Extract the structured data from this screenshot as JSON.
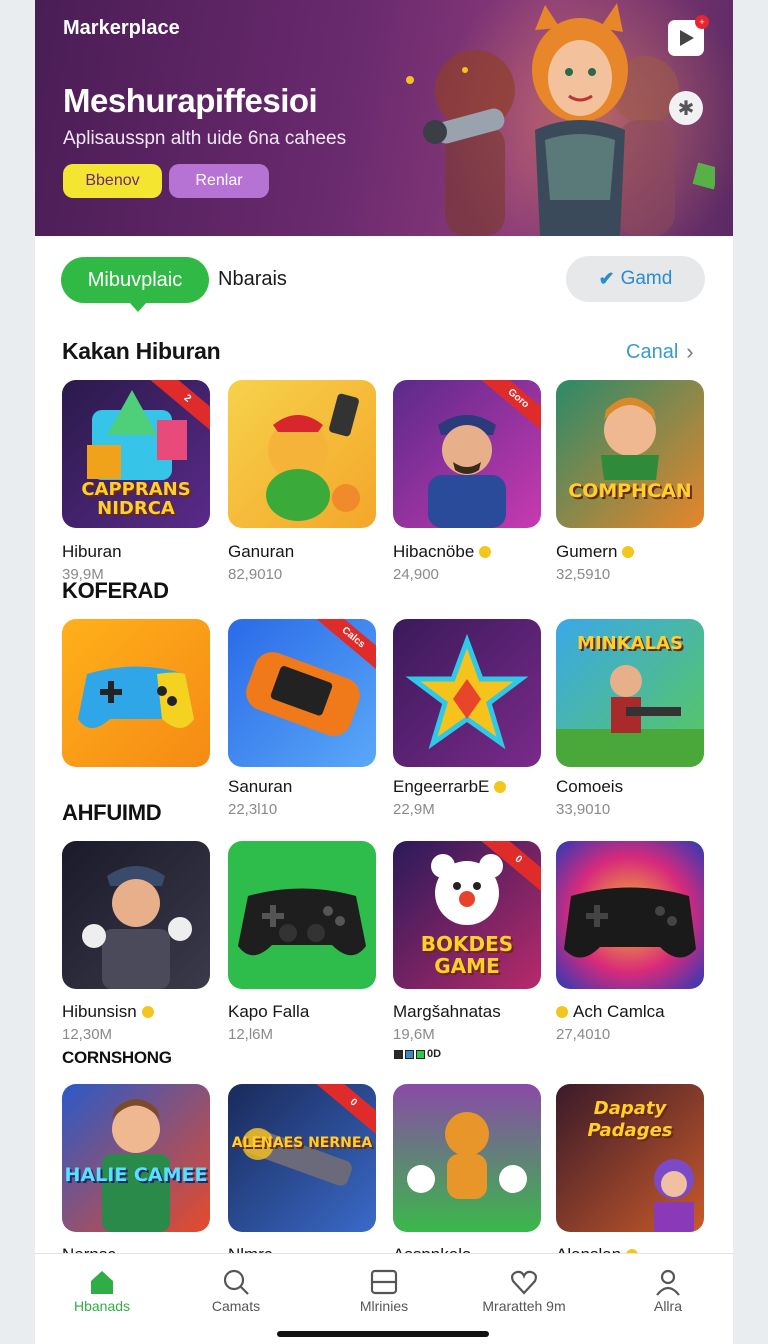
{
  "hero": {
    "market_label": "Markerplace",
    "title": "Meshurapiffesioi",
    "subtitle": "Aplisausspn alth uide 6na cahees",
    "button_primary": "Bbenov",
    "button_secondary": "Renlar"
  },
  "tabs": {
    "active": "Mibuvplaic",
    "other": "Nbarais",
    "game_button": "Gamd"
  },
  "section": {
    "title": "Kakan Hiburan",
    "see_all": "Canal"
  },
  "row_labels": [
    "KOFERAD",
    "AHFUIMD",
    "CORNSHONG"
  ],
  "rows": [
    [
      {
        "name": "Hiburan",
        "count": "39,9M",
        "coin": false,
        "tile_text": "CAPPRANS NIDRCA",
        "ribbon": "2"
      },
      {
        "name": "Ganuran",
        "count": "82,9010",
        "coin": false,
        "tile_text": "",
        "ribbon": ""
      },
      {
        "name": "Hibacnöbe",
        "count": "24,900",
        "coin": true,
        "tile_text": "",
        "ribbon": "Goro"
      },
      {
        "name": "Gumern",
        "count": "32,5910",
        "coin": true,
        "tile_text": "COMPHCAN",
        "ribbon": ""
      }
    ],
    [
      {
        "name": "",
        "count": "",
        "coin": false,
        "tile_text": "",
        "ribbon": ""
      },
      {
        "name": "Sanuran",
        "count": "22,3l10",
        "coin": false,
        "tile_text": "",
        "ribbon": "Calcs"
      },
      {
        "name": "EngeerrarbE",
        "count": "22,9M",
        "coin": true,
        "tile_text": "",
        "ribbon": ""
      },
      {
        "name": "Comoeis",
        "count": "33,9010",
        "coin": false,
        "tile_text": "MINKALAS",
        "ribbon": ""
      }
    ],
    [
      {
        "name": "Hibunsisn",
        "count": "12,30M",
        "coin": true,
        "tile_text": "",
        "ribbon": ""
      },
      {
        "name": "Kapo Falla",
        "count": "12,l6M",
        "coin": false,
        "tile_text": "",
        "ribbon": ""
      },
      {
        "name": "Margšahnatas",
        "count": "19,6M",
        "coin": false,
        "tile_text": "BOKDES GAME",
        "ribbon": "0"
      },
      {
        "name": "Ach Camlca",
        "count": "27,4010",
        "coin": true,
        "tile_text": "",
        "ribbon": ""
      }
    ],
    [
      {
        "name": "Nernsc",
        "count": "",
        "coin": false,
        "tile_text": "HALIE CAMEE",
        "ribbon": ""
      },
      {
        "name": "Nlmrc",
        "count": "",
        "coin": false,
        "tile_text": "ALENAES NERNEA",
        "ribbon": "0"
      },
      {
        "name": "Asspnkela",
        "count": "",
        "coin": false,
        "tile_text": "",
        "ribbon": ""
      },
      {
        "name": "Alanslan",
        "count": "",
        "coin": true,
        "tile_text": "Dapaty Padages",
        "ribbon": ""
      }
    ]
  ],
  "badge_text": "0D",
  "nav": [
    {
      "label": "Hbanads",
      "icon": "home-icon"
    },
    {
      "label": "Camats",
      "icon": "search-icon"
    },
    {
      "label": "Mlrinies",
      "icon": "inbox-icon"
    },
    {
      "label": "Mraratteh 9m",
      "icon": "heart-icon"
    },
    {
      "label": "Allra",
      "icon": "user-icon"
    }
  ],
  "colors": {
    "accent_green": "#31b946",
    "link_blue": "#3a9ad0",
    "hero_purple": "#5b2a63",
    "yellow_button": "#f4e531",
    "violet_button": "#b673d3"
  }
}
